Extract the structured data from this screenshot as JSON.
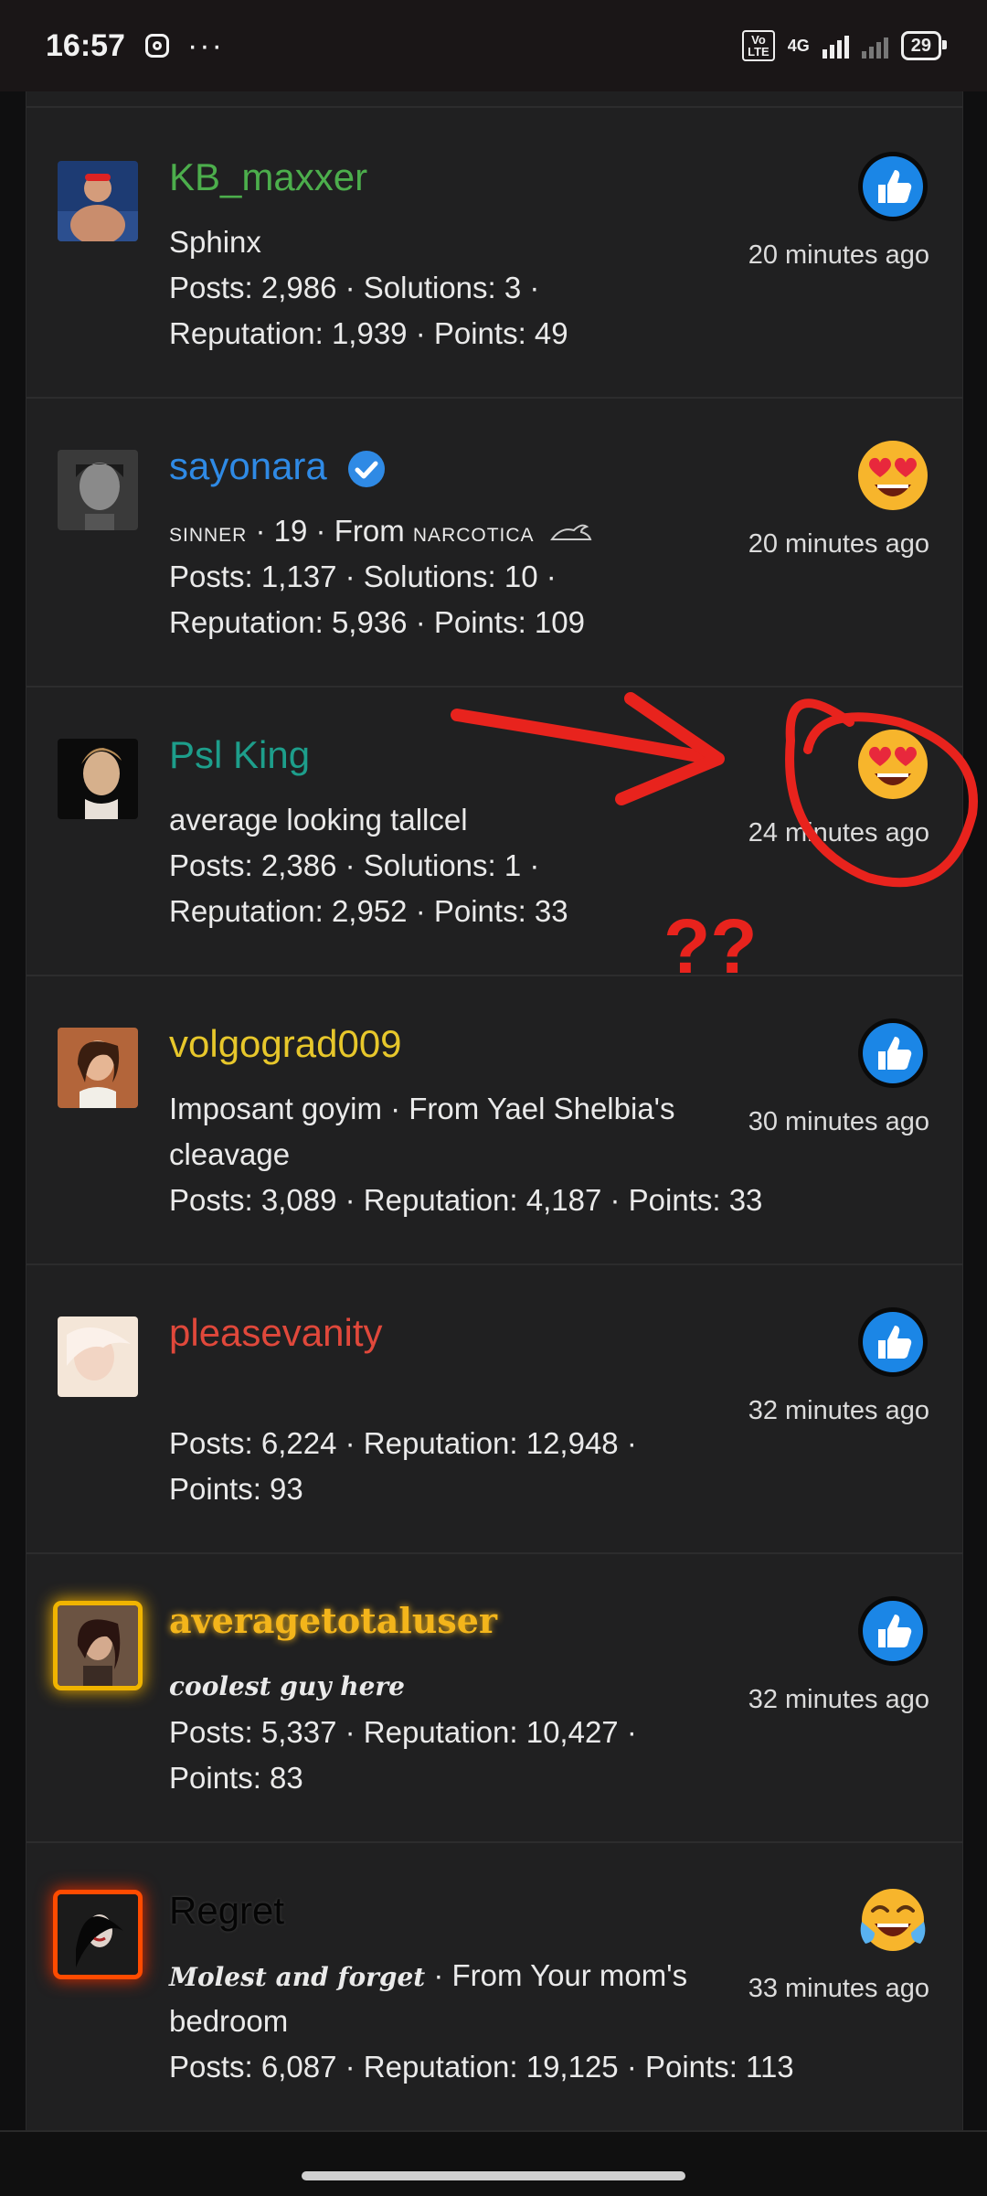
{
  "status_bar": {
    "time": "16:57",
    "volte": "Vo LTE",
    "network": "4G",
    "battery": "29"
  },
  "users": [
    {
      "username": "KB_maxxer",
      "color": "#4cae4c",
      "line1": "Sphinx",
      "line2": "Posts: 2,986 · Solutions: 3 ·",
      "line3": "Reputation: 1,939 · Points: 49",
      "reaction": "thumbs-up-icon",
      "time": "20 minutes ago"
    },
    {
      "username": "sayonara",
      "color": "#2f8ae5",
      "verified": true,
      "line1_a": "sinner",
      "line1_b": " · 19 · From ",
      "line1_c": "narcotica",
      "line2": "Posts: 1,137 · Solutions: 10 ·",
      "line3": "Reputation: 5,936 · Points: 109",
      "reaction": "heart-eyes-icon",
      "time": "20 minutes ago"
    },
    {
      "username": "Psl King",
      "color": "#1d9e8b",
      "line1": "average looking tallcel",
      "line2": "Posts: 2,386 · Solutions: 1 ·",
      "line3": "Reputation: 2,952 · Points: 33",
      "reaction": "heart-eyes-icon",
      "time": "24 minutes ago"
    },
    {
      "username": "volgograd009",
      "color": "#e7c72b",
      "line1": "Imposant goyim · From Yael Shelbia's",
      "line2": "cleavage",
      "line3": "Posts: 3,089 · Reputation: 4,187 · Points: 33",
      "reaction": "thumbs-up-icon",
      "time": "30 minutes ago"
    },
    {
      "username": "pleasevanity",
      "color": "#e0483b",
      "line2": "Posts: 6,224 · Reputation: 12,948 ·",
      "line3": "Points: 93",
      "reaction": "thumbs-up-icon",
      "time": "32 minutes ago"
    },
    {
      "username": "averagetotaluser",
      "color": "#f3b51b",
      "line1": "coolest guy here",
      "line2": "Posts: 5,337 · Reputation: 10,427 ·",
      "line3": "Points: 83",
      "reaction": "thumbs-up-icon",
      "time": "32 minutes ago"
    },
    {
      "username": "Regret",
      "color": "#050505",
      "line1_a": "Molest and forget",
      "line1_b": " · From Your mom's",
      "line2": "bedroom",
      "line3": "Posts: 6,087 · Reputation: 19,125 · Points: 113",
      "reaction": "tears-of-joy-icon",
      "time": "33 minutes ago"
    }
  ],
  "annotation": {
    "text": "??",
    "color": "#e8231d"
  }
}
